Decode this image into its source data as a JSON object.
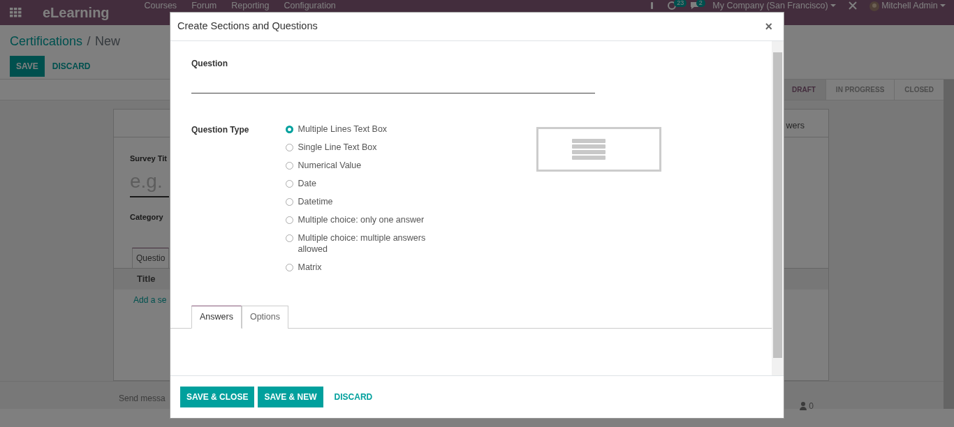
{
  "navbar": {
    "app_title": "eLearning",
    "menu": [
      "Courses",
      "Forum",
      "Reporting",
      "Configuration"
    ],
    "activity_count": "23",
    "message_count": "2",
    "company": "My Company (San Francisco)",
    "user": "Mitchell Admin"
  },
  "breadcrumb": {
    "parent": "Certifications",
    "separator": "/",
    "current": "New"
  },
  "actions": [
    {
      "label": "SAVE",
      "kind": "primary"
    },
    {
      "label": "DISCARD",
      "kind": "link"
    }
  ],
  "stages": [
    {
      "label": "DRAFT",
      "selected": true
    },
    {
      "label": "IN PROGRESS",
      "selected": false
    },
    {
      "label": "CLOSED",
      "selected": false
    }
  ],
  "sheet": {
    "button_box_text": "wers",
    "title_label": "Survey Tit",
    "title_placeholder": "e.g.",
    "category_label": "Category",
    "tab": "Questio",
    "table_header": "Title",
    "add_link": "Add a se"
  },
  "chatter": {
    "send_message": "Send messa",
    "followers": "0"
  },
  "dialog": {
    "title": "Create Sections and Questions",
    "close": "×",
    "question_label": "Question",
    "question_type_label": "Question Type",
    "question_types": [
      {
        "label": "Multiple Lines Text Box",
        "selected": true
      },
      {
        "label": "Single Line Text Box",
        "selected": false
      },
      {
        "label": "Numerical Value",
        "selected": false
      },
      {
        "label": "Date",
        "selected": false
      },
      {
        "label": "Datetime",
        "selected": false
      },
      {
        "label": "Multiple choice: only one answer",
        "selected": false
      },
      {
        "label": "Multiple choice: multiple answers allowed",
        "selected": false
      },
      {
        "label": "Matrix",
        "selected": false
      }
    ],
    "tabs": [
      {
        "label": "Answers",
        "selected": true
      },
      {
        "label": "Options",
        "selected": false
      }
    ],
    "buttons": [
      {
        "label": "SAVE & CLOSE",
        "kind": "primary"
      },
      {
        "label": "SAVE & NEW",
        "kind": "primary"
      },
      {
        "label": "DISCARD",
        "kind": "link"
      }
    ]
  }
}
